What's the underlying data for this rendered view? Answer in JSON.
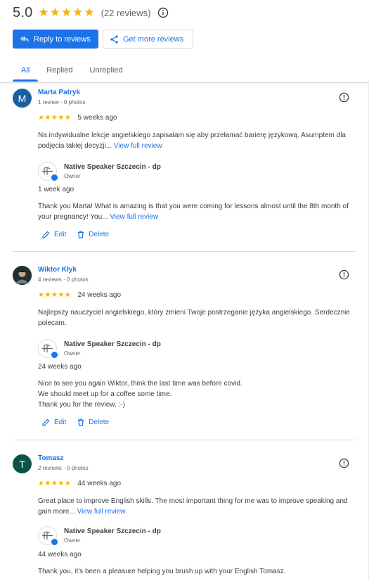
{
  "summary": {
    "rating": "5.0",
    "stars": "★★★★★",
    "count": "(22 reviews)",
    "info_icon": "info-icon"
  },
  "actions": {
    "reply_label": "Reply to reviews",
    "reply_icon": "reply-all-icon",
    "more_label": "Get more reviews",
    "more_icon": "share-icon"
  },
  "tabs": [
    {
      "label": "All",
      "active": true
    },
    {
      "label": "Replied",
      "active": false
    },
    {
      "label": "Unreplied",
      "active": false
    }
  ],
  "colors": {
    "accent": "#1a73e8",
    "star": "#f4b400",
    "avatar_m": "#1a5fa0",
    "avatar_t": "#0b5344"
  },
  "reviews": [
    {
      "avatar_letter": "M",
      "name": "Marta Patryk",
      "meta": "1 review · 0 photos",
      "stars": "★★★★★",
      "ago": "5 weeks ago",
      "text": "Na indywidualne lekcje angielskiego zapisałam się aby przełamać barierę językową. Asumptem dla podjęcia takiej decyzji...",
      "link": "View full review",
      "owner_name": "Native Speaker Szczecin - dp",
      "owner_role": "Owner",
      "reply_ago": "1 week ago",
      "reply": "Thank you Marta! What is amazing is that you were coming for lessons almost until the 8th month of your pregnancy! You...",
      "reply_link": "View full review",
      "edit": "Edit",
      "delete": "Delete"
    },
    {
      "avatar_letter": "",
      "name": "Wiktor Kłyk",
      "meta": "4 reviews · 0 photos",
      "stars": "★★★★★",
      "ago": "24 weeks ago",
      "text": "Najlepszy nauczyciel angielskiego, który zmieni Twoje postrzeganie języka angielskiego. Serdecznie polecam.",
      "owner_name": "Native Speaker Szczecin - dp",
      "owner_role": "Owner",
      "reply_ago": "24 weeks ago",
      "reply_lines": [
        "Nice to see you again Wiktor, think the last time was before covid.",
        "We should meet up for a coffee some time.",
        "Thank you for the review. :-)"
      ],
      "edit": "Edit",
      "delete": "Delete"
    },
    {
      "avatar_letter": "T",
      "name": "Tomasz",
      "meta": "2 reviews · 0 photos",
      "stars": "★★★★★",
      "ago": "44 weeks ago",
      "text": "Great place to improve English skills. The most important thing for me was to improve speaking and gain more...",
      "link": "View full review",
      "owner_name": "Native Speaker Szczecin - dp",
      "owner_role": "Owner",
      "reply_ago": "44 weeks ago",
      "reply": "Thank you, it's been a pleasure helping you brush up with your English Tomasz."
    }
  ]
}
